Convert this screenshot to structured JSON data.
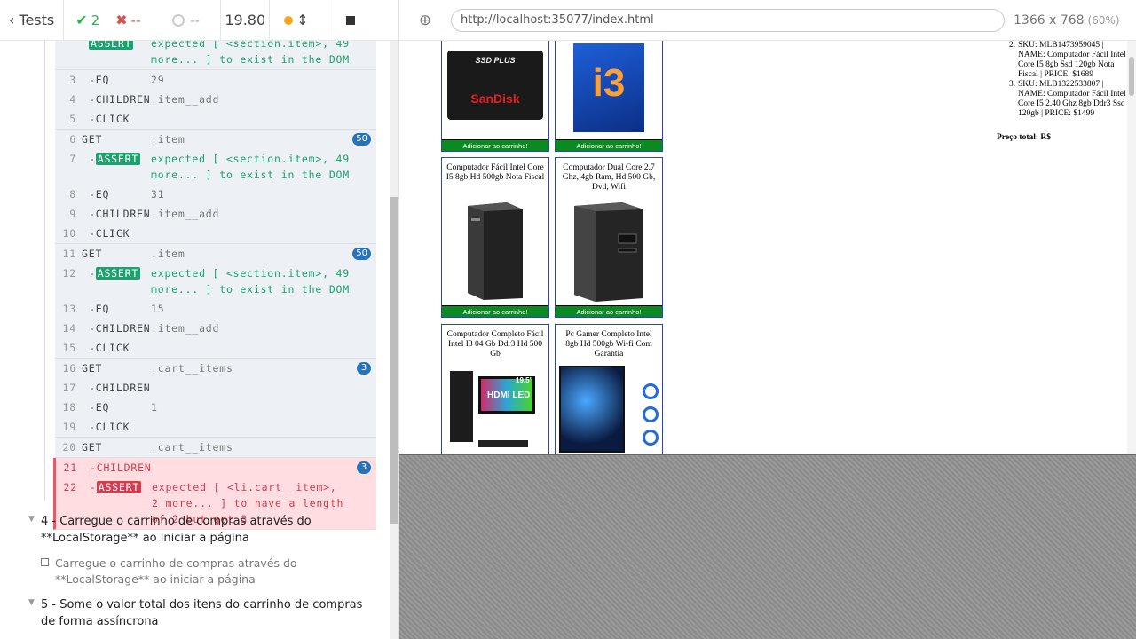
{
  "toolbar": {
    "tests_label": "Tests",
    "passed": "2",
    "failed": "--",
    "pending": "--",
    "duration": "19.80"
  },
  "browser": {
    "url": "http://localhost:35077/index.html",
    "viewport": "1366 x 768",
    "scale": "(60%)"
  },
  "commands": {
    "top_partial": "expected [ <section.item>, 49 more... ] to exist in the DOM",
    "groups": [
      {
        "rows": [
          {
            "num": "3",
            "name": "-EQ",
            "msg": "29"
          },
          {
            "num": "4",
            "name": "-CHILDREN",
            "msg": ".item__add"
          },
          {
            "num": "5",
            "name": "-CLICK",
            "msg": ""
          }
        ]
      },
      {
        "count": "50",
        "rows": [
          {
            "num": "6",
            "name": "GET",
            "msg": ".item"
          },
          {
            "num": "7",
            "name": "-ASSERT",
            "msg": "expected [ <section.item>, 49 more... ] to exist in the DOM"
          },
          {
            "num": "8",
            "name": "-EQ",
            "msg": "31"
          },
          {
            "num": "9",
            "name": "-CHILDREN",
            "msg": ".item__add"
          },
          {
            "num": "10",
            "name": "-CLICK",
            "msg": ""
          }
        ]
      },
      {
        "count": "50",
        "rows": [
          {
            "num": "11",
            "name": "GET",
            "msg": ".item"
          },
          {
            "num": "12",
            "name": "-ASSERT",
            "msg": "expected [ <section.item>, 49 more... ] to exist in the DOM"
          },
          {
            "num": "13",
            "name": "-EQ",
            "msg": "15"
          },
          {
            "num": "14",
            "name": "-CHILDREN",
            "msg": ".item__add"
          },
          {
            "num": "15",
            "name": "-CLICK",
            "msg": ""
          }
        ]
      },
      {
        "count": "3",
        "rows": [
          {
            "num": "16",
            "name": "GET",
            "msg": ".cart__items"
          },
          {
            "num": "17",
            "name": "-CHILDREN",
            "msg": ""
          },
          {
            "num": "18",
            "name": "-EQ",
            "msg": "1"
          },
          {
            "num": "19",
            "name": "-CLICK",
            "msg": ""
          }
        ]
      },
      {
        "rows": [
          {
            "num": "20",
            "name": "GET",
            "msg": ".cart__items"
          }
        ]
      },
      {
        "count": "3",
        "failed": true,
        "rows": [
          {
            "num": "21",
            "name": "-CHILDREN",
            "msg": ""
          },
          {
            "num": "22",
            "name": "-ASSERT",
            "msg": "expected [ <li.cart__item>, 2 more... ] to have a length of 2 but got 3"
          }
        ]
      }
    ]
  },
  "suites": [
    {
      "title": "4 - Carregue o carrinho de compras através do **LocalStorage** ao iniciar a página",
      "test": "Carregue o carrinho de compras através do **LocalStorage** ao iniciar a página"
    },
    {
      "title": "5 - Some o valor total dos itens do carrinho de compras de forma assíncrona"
    }
  ],
  "app": {
    "add_label": "Adicionar ao carrinho!",
    "products": [
      {
        "name": "",
        "image": "ssd-image"
      },
      {
        "name": "",
        "image": "cpu-image"
      },
      {
        "name": "Computador Fácil Intel Core I5 8gb Hd 500gb Nota Fiscal",
        "image": "pc-case-image"
      },
      {
        "name": "Computador Dual Core 2.7 Ghz, 4gb Ram, Hd 500 Gb, Dvd, Wifi",
        "image": "pc-case-image"
      },
      {
        "name": "Computador Completo Fácil Intel I3 04 Gb Ddr3 Hd 500 Gb",
        "image": "pc-kit-image"
      },
      {
        "name": "Pc Gamer Completo Intel 8gb Hd 500gb Wi-fi Com Garantia",
        "image": "gamer-pc-image"
      }
    ],
    "ssd_text": {
      "line1": "SSD PLUS",
      "brand": "SanDisk"
    },
    "cpu_text": "i3",
    "monitor_text": {
      "hdmi": "HDMI",
      "led": "LED",
      "size": "19.5\""
    },
    "cart_items": [
      {
        "n": "2.",
        "text": "SKU: MLB1473959045 | NAME: Computador Fácil Intel Core I5 8gb Ssd 120gb Nota Fiscal | PRICE: $1689"
      },
      {
        "n": "3.",
        "text": "SKU: MLB1322533807 | NAME: Computador Fácil Intel Core I5 2.40 Ghz 8gb Ddr3 Ssd 120gb | PRICE: $1499"
      }
    ],
    "total_label": "Preço total: R$"
  },
  "colors": {
    "pass": "#2bb24c",
    "fail": "#e04e4e",
    "assert_green": "#1aa36d",
    "assert_red": "#d53b4f",
    "badge_blue": "#2673bd",
    "add_button": "#0b8a21",
    "item_border": "#2846c2"
  }
}
